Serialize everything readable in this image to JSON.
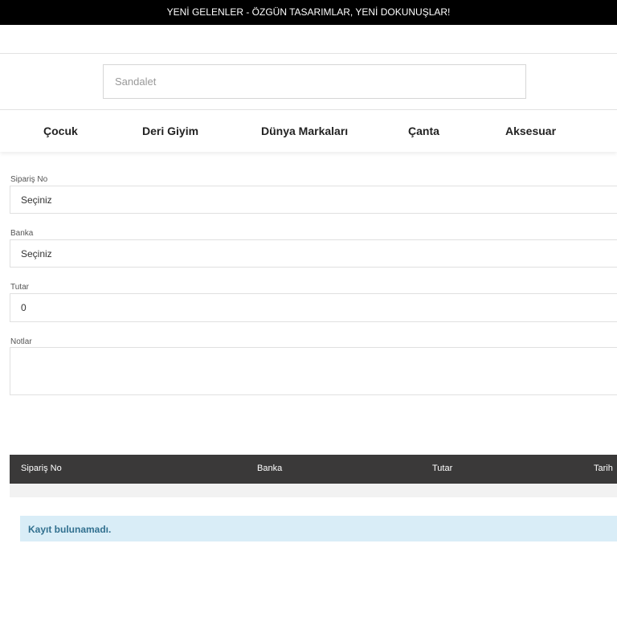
{
  "announcement": "YENİ GELENLER - ÖZGÜN TASARIMLAR, YENİ DOKUNUŞLAR!",
  "search": {
    "placeholder": "Sandalet"
  },
  "nav": [
    "Çocuk",
    "Deri Giyim",
    "Dünya Markaları",
    "Çanta",
    "Aksesuar"
  ],
  "form": {
    "order_label": "Sipariş No",
    "order_value": "Seçiniz",
    "bank_label": "Banka",
    "bank_value": "Seçiniz",
    "amount_label": "Tutar",
    "amount_value": "0",
    "notes_label": "Notlar",
    "notes_value": ""
  },
  "table": {
    "columns": [
      "Sipariş No",
      "Banka",
      "Tutar",
      "Tarih"
    ]
  },
  "empty_message": "Kayıt bulunamadı."
}
